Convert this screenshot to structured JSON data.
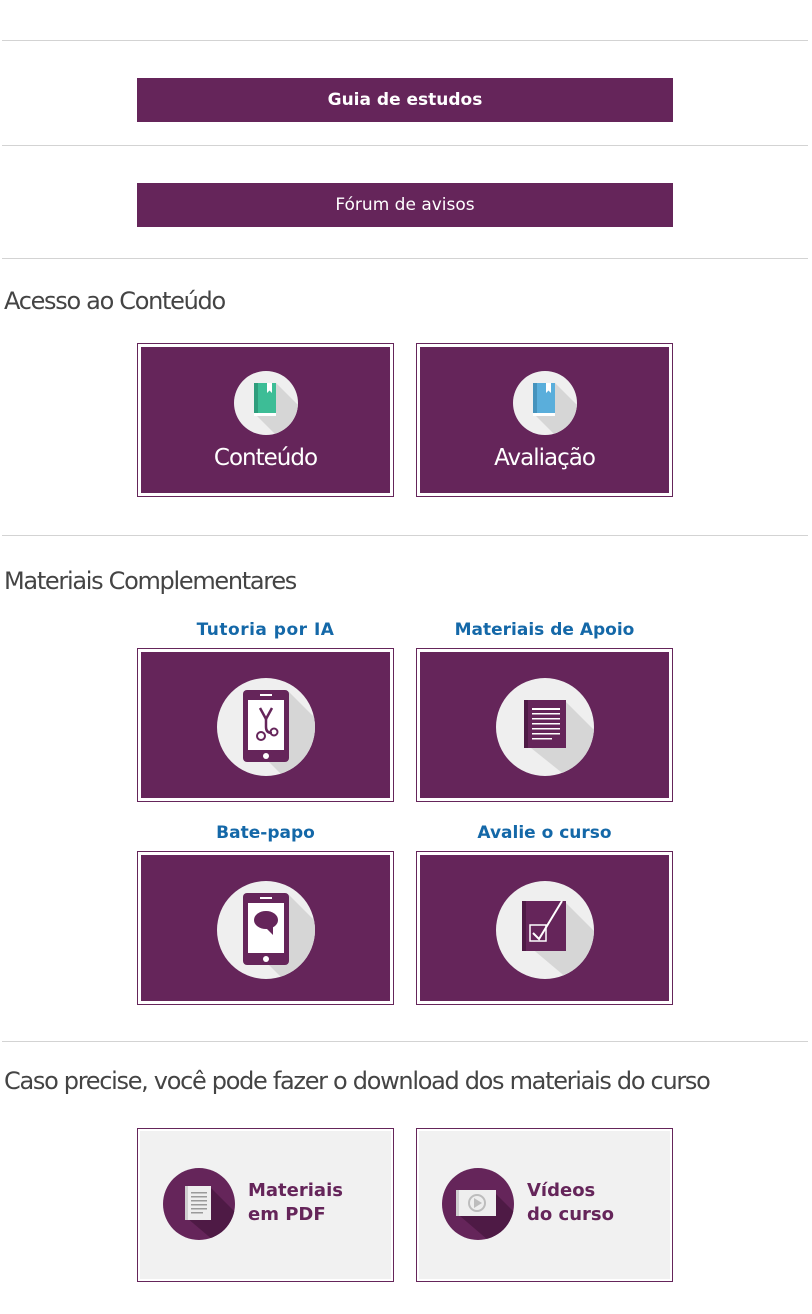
{
  "nav_buttons": {
    "study_guide": "Guia de estudos",
    "notice_forum": "Fórum de avisos"
  },
  "access": {
    "title": "Acesso ao Conteúdo",
    "tiles": [
      {
        "label": "Conteúdo",
        "icon": "book-icon"
      },
      {
        "label": "Avaliação",
        "icon": "book-icon"
      }
    ]
  },
  "supplementary": {
    "title": "Materiais Complementares",
    "items": [
      {
        "caption": "Tutoria por IA",
        "icon": "tablet-stethoscope-icon"
      },
      {
        "caption": "Materiais de Apoio",
        "icon": "document-icon"
      },
      {
        "caption": "Bate-papo",
        "icon": "tablet-chat-icon"
      },
      {
        "caption": "Avalie o curso",
        "icon": "checklist-icon"
      }
    ]
  },
  "downloads": {
    "title": "Caso precise, você pode fazer o download dos materiais do curso",
    "items": [
      {
        "line1": "Materiais",
        "line2": "em PDF",
        "icon": "pdf-document-icon"
      },
      {
        "line1": "Vídeos",
        "line2": "do curso",
        "icon": "video-play-icon"
      }
    ]
  },
  "colors": {
    "brand_purple": "#65255a",
    "caption_blue": "#1468a8",
    "book_green": "#3dbd96",
    "book_blue": "#5aaedb"
  }
}
